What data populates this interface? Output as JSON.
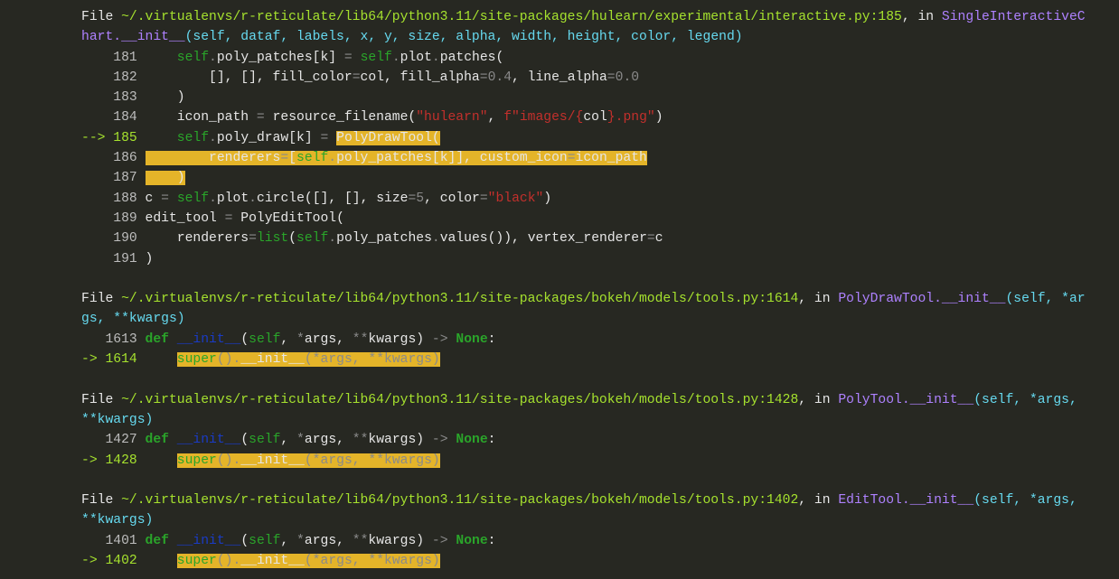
{
  "frames": [
    {
      "header_lines": [
        [
          {
            "t": "File ",
            "c": "w"
          },
          {
            "t": "~/.virtualenvs/r-reticulate/lib64/python3.11/site-packages/hulearn/experimental/interactive.py:185",
            "c": "path"
          },
          {
            "t": ", in ",
            "c": "w"
          },
          {
            "t": "SingleInteractiveC",
            "c": "fn"
          }
        ],
        [
          {
            "t": "hart.__init__",
            "c": "fn"
          },
          {
            "t": "(self, dataf, labels, x, y, size, alpha, width, height, color, legend)",
            "c": "cy"
          }
        ]
      ],
      "code_lines": [
        [
          {
            "t": "    181 ",
            "c": "lno"
          },
          {
            "t": "    ",
            "c": "w"
          },
          {
            "t": "self",
            "c": "kw"
          },
          {
            "t": ".",
            "c": "op"
          },
          {
            "t": "poly_patches[k] ",
            "c": "w"
          },
          {
            "t": "=",
            "c": "op"
          },
          {
            "t": " ",
            "c": "w"
          },
          {
            "t": "self",
            "c": "kw"
          },
          {
            "t": ".",
            "c": "op"
          },
          {
            "t": "plot",
            "c": "w"
          },
          {
            "t": ".",
            "c": "op"
          },
          {
            "t": "patches(",
            "c": "w"
          }
        ],
        [
          {
            "t": "    182 ",
            "c": "lno"
          },
          {
            "t": "        [], [], fill_color",
            "c": "w"
          },
          {
            "t": "=",
            "c": "op"
          },
          {
            "t": "col, fill_alpha",
            "c": "w"
          },
          {
            "t": "=",
            "c": "op"
          },
          {
            "t": "0.4",
            "c": "op"
          },
          {
            "t": ", line_alpha",
            "c": "w"
          },
          {
            "t": "=",
            "c": "op"
          },
          {
            "t": "0.0",
            "c": "op"
          }
        ],
        [
          {
            "t": "    183 ",
            "c": "lno"
          },
          {
            "t": "    )",
            "c": "w"
          }
        ],
        [
          {
            "t": "    184 ",
            "c": "lno"
          },
          {
            "t": "    icon_path ",
            "c": "w"
          },
          {
            "t": "=",
            "c": "op"
          },
          {
            "t": " resource_filename(",
            "c": "w"
          },
          {
            "t": "\"hulearn\"",
            "c": "str"
          },
          {
            "t": ", ",
            "c": "w"
          },
          {
            "t": "f\"images/",
            "c": "str"
          },
          {
            "t": "{",
            "c": "str"
          },
          {
            "t": "col",
            "c": "w"
          },
          {
            "t": "}",
            "c": "str"
          },
          {
            "t": ".png\"",
            "c": "str"
          },
          {
            "t": ")",
            "c": "w"
          }
        ],
        [
          {
            "t": "--> 185 ",
            "c": "arrow"
          },
          {
            "t": "    ",
            "c": "w"
          },
          {
            "t": "self",
            "c": "kw"
          },
          {
            "t": ".",
            "c": "op"
          },
          {
            "t": "poly_draw[k] ",
            "c": "w"
          },
          {
            "t": "=",
            "c": "op"
          },
          {
            "t": " ",
            "c": "w"
          },
          {
            "t": "PolyDrawTool(",
            "c": "w",
            "h": true
          }
        ],
        [
          {
            "t": "    186 ",
            "c": "lno"
          },
          {
            "t": "        renderers",
            "c": "w",
            "h": true
          },
          {
            "t": "=",
            "c": "op",
            "h": true
          },
          {
            "t": "[",
            "c": "w",
            "h": true
          },
          {
            "t": "self",
            "c": "kw",
            "h": true
          },
          {
            "t": ".",
            "c": "op",
            "h": true
          },
          {
            "t": "poly_patches[k]], custom_icon",
            "c": "w",
            "h": true
          },
          {
            "t": "=",
            "c": "op",
            "h": true
          },
          {
            "t": "icon_path",
            "c": "w",
            "h": true
          }
        ],
        [
          {
            "t": "    187 ",
            "c": "lno"
          },
          {
            "t": "    )",
            "c": "w",
            "h": true
          }
        ],
        [
          {
            "t": "    188 ",
            "c": "lno"
          },
          {
            "t": "c ",
            "c": "w"
          },
          {
            "t": "=",
            "c": "op"
          },
          {
            "t": " ",
            "c": "w"
          },
          {
            "t": "self",
            "c": "kw"
          },
          {
            "t": ".",
            "c": "op"
          },
          {
            "t": "plot",
            "c": "w"
          },
          {
            "t": ".",
            "c": "op"
          },
          {
            "t": "circle([], [], size",
            "c": "w"
          },
          {
            "t": "=",
            "c": "op"
          },
          {
            "t": "5",
            "c": "op"
          },
          {
            "t": ", color",
            "c": "w"
          },
          {
            "t": "=",
            "c": "op"
          },
          {
            "t": "\"black\"",
            "c": "str"
          },
          {
            "t": ")",
            "c": "w"
          }
        ],
        [
          {
            "t": "    189 ",
            "c": "lno"
          },
          {
            "t": "edit_tool ",
            "c": "w"
          },
          {
            "t": "=",
            "c": "op"
          },
          {
            "t": " PolyEditTool(",
            "c": "w"
          }
        ],
        [
          {
            "t": "    190 ",
            "c": "lno"
          },
          {
            "t": "    renderers",
            "c": "w"
          },
          {
            "t": "=",
            "c": "op"
          },
          {
            "t": "list",
            "c": "kw"
          },
          {
            "t": "(",
            "c": "w"
          },
          {
            "t": "self",
            "c": "kw"
          },
          {
            "t": ".",
            "c": "op"
          },
          {
            "t": "poly_patches",
            "c": "w"
          },
          {
            "t": ".",
            "c": "op"
          },
          {
            "t": "values()), vertex_renderer",
            "c": "w"
          },
          {
            "t": "=",
            "c": "op"
          },
          {
            "t": "c",
            "c": "w"
          }
        ],
        [
          {
            "t": "    191 ",
            "c": "lno"
          },
          {
            "t": ")",
            "c": "w"
          }
        ]
      ]
    },
    {
      "header_lines": [
        [
          {
            "t": "File ",
            "c": "w"
          },
          {
            "t": "~/.virtualenvs/r-reticulate/lib64/python3.11/site-packages/bokeh/models/tools.py:1614",
            "c": "path"
          },
          {
            "t": ", in ",
            "c": "w"
          },
          {
            "t": "PolyDrawTool.__init__",
            "c": "fn"
          },
          {
            "t": "(self, *ar",
            "c": "cy"
          }
        ],
        [
          {
            "t": "gs, **kwargs)",
            "c": "cy"
          }
        ]
      ],
      "code_lines": [
        [
          {
            "t": "   1613 ",
            "c": "lno"
          },
          {
            "t": "def",
            "c": "kb"
          },
          {
            "t": " ",
            "c": "w"
          },
          {
            "t": "__init__",
            "c": "dk"
          },
          {
            "t": "(",
            "c": "w"
          },
          {
            "t": "self",
            "c": "kw"
          },
          {
            "t": ", ",
            "c": "w"
          },
          {
            "t": "*",
            "c": "op"
          },
          {
            "t": "args, ",
            "c": "w"
          },
          {
            "t": "**",
            "c": "op"
          },
          {
            "t": "kwargs) ",
            "c": "w"
          },
          {
            "t": "->",
            "c": "op"
          },
          {
            "t": " ",
            "c": "w"
          },
          {
            "t": "None",
            "c": "kb"
          },
          {
            "t": ":",
            "c": "w"
          }
        ],
        [
          {
            "t": "-> 1614 ",
            "c": "arrow"
          },
          {
            "t": "    ",
            "c": "w"
          },
          {
            "t": "super",
            "c": "kw",
            "h": true
          },
          {
            "t": "()",
            "c": "op",
            "h": true
          },
          {
            "t": ".",
            "c": "op",
            "h": true
          },
          {
            "t": "__init__",
            "c": "w",
            "h": true
          },
          {
            "t": "(",
            "c": "op",
            "h": true
          },
          {
            "t": "*",
            "c": "op",
            "h": true
          },
          {
            "t": "args, ",
            "c": "op",
            "h": true
          },
          {
            "t": "**",
            "c": "op",
            "h": true
          },
          {
            "t": "kwargs)",
            "c": "op",
            "h": true
          }
        ]
      ]
    },
    {
      "header_lines": [
        [
          {
            "t": "File ",
            "c": "w"
          },
          {
            "t": "~/.virtualenvs/r-reticulate/lib64/python3.11/site-packages/bokeh/models/tools.py:1428",
            "c": "path"
          },
          {
            "t": ", in ",
            "c": "w"
          },
          {
            "t": "PolyTool.__init__",
            "c": "fn"
          },
          {
            "t": "(self, *args,",
            "c": "cy"
          }
        ],
        [
          {
            "t": "**kwargs)",
            "c": "cy"
          }
        ]
      ],
      "code_lines": [
        [
          {
            "t": "   1427 ",
            "c": "lno"
          },
          {
            "t": "def",
            "c": "kb"
          },
          {
            "t": " ",
            "c": "w"
          },
          {
            "t": "__init__",
            "c": "dk"
          },
          {
            "t": "(",
            "c": "w"
          },
          {
            "t": "self",
            "c": "kw"
          },
          {
            "t": ", ",
            "c": "w"
          },
          {
            "t": "*",
            "c": "op"
          },
          {
            "t": "args, ",
            "c": "w"
          },
          {
            "t": "**",
            "c": "op"
          },
          {
            "t": "kwargs) ",
            "c": "w"
          },
          {
            "t": "->",
            "c": "op"
          },
          {
            "t": " ",
            "c": "w"
          },
          {
            "t": "None",
            "c": "kb"
          },
          {
            "t": ":",
            "c": "w"
          }
        ],
        [
          {
            "t": "-> 1428 ",
            "c": "arrow"
          },
          {
            "t": "    ",
            "c": "w"
          },
          {
            "t": "super",
            "c": "kw",
            "h": true
          },
          {
            "t": "()",
            "c": "op",
            "h": true
          },
          {
            "t": ".",
            "c": "op",
            "h": true
          },
          {
            "t": "__init__",
            "c": "w",
            "h": true
          },
          {
            "t": "(",
            "c": "op",
            "h": true
          },
          {
            "t": "*",
            "c": "op",
            "h": true
          },
          {
            "t": "args, ",
            "c": "op",
            "h": true
          },
          {
            "t": "**",
            "c": "op",
            "h": true
          },
          {
            "t": "kwargs)",
            "c": "op",
            "h": true
          }
        ]
      ]
    },
    {
      "header_lines": [
        [
          {
            "t": "File ",
            "c": "w"
          },
          {
            "t": "~/.virtualenvs/r-reticulate/lib64/python3.11/site-packages/bokeh/models/tools.py:1402",
            "c": "path"
          },
          {
            "t": ", in ",
            "c": "w"
          },
          {
            "t": "EditTool.__init__",
            "c": "fn"
          },
          {
            "t": "(self, *args,",
            "c": "cy"
          }
        ],
        [
          {
            "t": "**kwargs)",
            "c": "cy"
          }
        ]
      ],
      "code_lines": [
        [
          {
            "t": "   1401 ",
            "c": "lno"
          },
          {
            "t": "def",
            "c": "kb"
          },
          {
            "t": " ",
            "c": "w"
          },
          {
            "t": "__init__",
            "c": "dk"
          },
          {
            "t": "(",
            "c": "w"
          },
          {
            "t": "self",
            "c": "kw"
          },
          {
            "t": ", ",
            "c": "w"
          },
          {
            "t": "*",
            "c": "op"
          },
          {
            "t": "args, ",
            "c": "w"
          },
          {
            "t": "**",
            "c": "op"
          },
          {
            "t": "kwargs) ",
            "c": "w"
          },
          {
            "t": "->",
            "c": "op"
          },
          {
            "t": " ",
            "c": "w"
          },
          {
            "t": "None",
            "c": "kb"
          },
          {
            "t": ":",
            "c": "w"
          }
        ],
        [
          {
            "t": "-> 1402 ",
            "c": "arrow"
          },
          {
            "t": "    ",
            "c": "w"
          },
          {
            "t": "super",
            "c": "kw",
            "h": true
          },
          {
            "t": "()",
            "c": "op",
            "h": true
          },
          {
            "t": ".",
            "c": "op",
            "h": true
          },
          {
            "t": "__init__",
            "c": "w",
            "h": true
          },
          {
            "t": "(",
            "c": "op",
            "h": true
          },
          {
            "t": "*",
            "c": "op",
            "h": true
          },
          {
            "t": "args, ",
            "c": "op",
            "h": true
          },
          {
            "t": "**",
            "c": "op",
            "h": true
          },
          {
            "t": "kwargs)",
            "c": "op",
            "h": true
          }
        ]
      ]
    }
  ]
}
